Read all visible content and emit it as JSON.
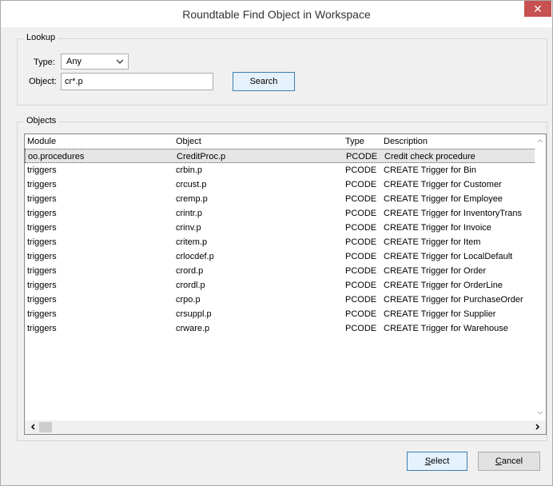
{
  "window": {
    "title": "Roundtable Find Object in Workspace",
    "close_glyph": "✕"
  },
  "lookup": {
    "caption": "Lookup",
    "type_label": "Type:",
    "type_value": "Any",
    "object_label": "Object:",
    "object_value": "cr*.p",
    "search_label": "Search"
  },
  "objects": {
    "caption": "Objects",
    "columns": [
      "Module",
      "Object",
      "Type",
      "Description"
    ],
    "rows": [
      {
        "module": "oo.procedures",
        "object": "CreditProc.p",
        "type": "PCODE",
        "description": "Credit check procedure"
      },
      {
        "module": "triggers",
        "object": "crbin.p",
        "type": "PCODE",
        "description": "CREATE Trigger for Bin"
      },
      {
        "module": "triggers",
        "object": "crcust.p",
        "type": "PCODE",
        "description": "CREATE Trigger for Customer"
      },
      {
        "module": "triggers",
        "object": "cremp.p",
        "type": "PCODE",
        "description": "CREATE Trigger for Employee"
      },
      {
        "module": "triggers",
        "object": "crintr.p",
        "type": "PCODE",
        "description": "CREATE Trigger for InventoryTrans"
      },
      {
        "module": "triggers",
        "object": "crinv.p",
        "type": "PCODE",
        "description": "CREATE Trigger for Invoice"
      },
      {
        "module": "triggers",
        "object": "critem.p",
        "type": "PCODE",
        "description": "CREATE Trigger for Item"
      },
      {
        "module": "triggers",
        "object": "crlocdef.p",
        "type": "PCODE",
        "description": "CREATE Trigger for LocalDefault"
      },
      {
        "module": "triggers",
        "object": "crord.p",
        "type": "PCODE",
        "description": "CREATE Trigger for Order"
      },
      {
        "module": "triggers",
        "object": "crordl.p",
        "type": "PCODE",
        "description": "CREATE Trigger for OrderLine"
      },
      {
        "module": "triggers",
        "object": "crpo.p",
        "type": "PCODE",
        "description": "CREATE Trigger for PurchaseOrder"
      },
      {
        "module": "triggers",
        "object": "crsuppl.p",
        "type": "PCODE",
        "description": "CREATE Trigger for Supplier"
      },
      {
        "module": "triggers",
        "object": "crware.p",
        "type": "PCODE",
        "description": "CREATE Trigger for Warehouse"
      }
    ]
  },
  "footer": {
    "select_accel": "S",
    "select_rest": "elect",
    "cancel_accel": "C",
    "cancel_rest": "ancel"
  },
  "colors": {
    "close": "#c75050",
    "selection": "#e5e5e5"
  }
}
